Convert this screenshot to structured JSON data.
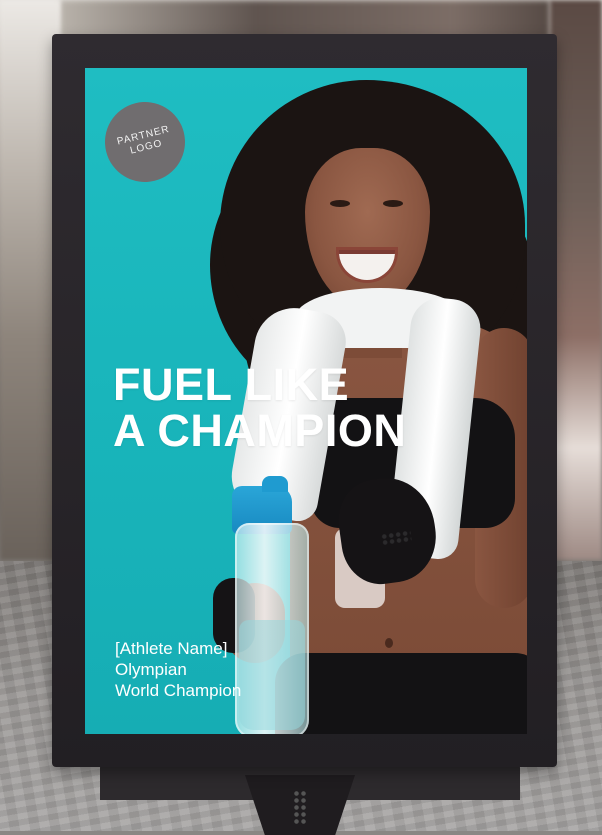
{
  "poster": {
    "logo_lines": [
      "PARTNER",
      "LOGO"
    ],
    "headline_lines": [
      "FUEL LIKE",
      "A CHAMPION"
    ],
    "credit_lines": [
      "[Athlete Name]",
      "Olympian",
      "World Champion"
    ],
    "colors": {
      "background": "#1bb8be",
      "logo_circle": "#706d6f",
      "text": "#ffffff",
      "frame": "#2b272c",
      "bottle_cap": "#2aa6d8"
    }
  },
  "icons": [
    "partner-logo",
    "water-bottle"
  ]
}
